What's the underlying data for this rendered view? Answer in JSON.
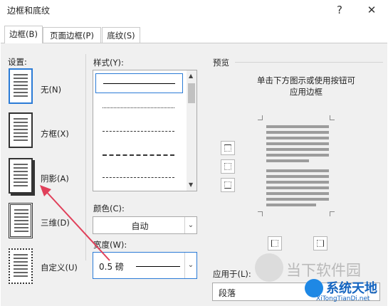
{
  "window": {
    "title": "边框和底纹",
    "help_label": "?",
    "close_label": "✕"
  },
  "tabs": [
    "边框(B)",
    "页面边框(P)",
    "底纹(S)"
  ],
  "settings": {
    "header": "设置:",
    "items": [
      "无(N)",
      "方框(X)",
      "阴影(A)",
      "三维(D)",
      "自定义(U)"
    ]
  },
  "style": {
    "label": "样式(Y):"
  },
  "color": {
    "label": "颜色(C):",
    "value": "自动"
  },
  "width": {
    "label": "宽度(W):",
    "value": "0.5 磅"
  },
  "preview": {
    "header": "预览",
    "instructions_line1": "单击下方图示或使用按钮可",
    "instructions_line2": "应用边框"
  },
  "apply_to": {
    "label": "应用于(L):",
    "value": "段落"
  },
  "watermark": {
    "text1": "当下软件园",
    "text2": "系统天地",
    "text3": "XiTongTianDi.net"
  },
  "colors": {
    "accent": "#2b7bd6",
    "arrow": "#e0405a"
  }
}
